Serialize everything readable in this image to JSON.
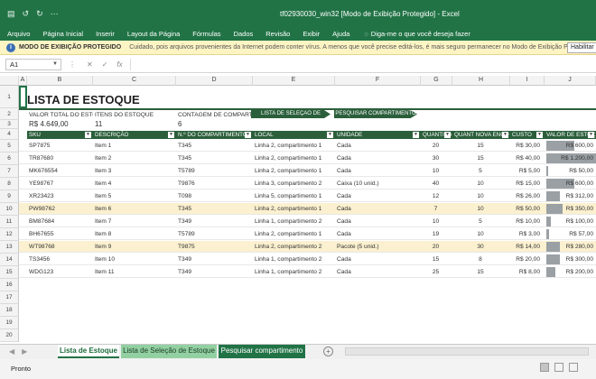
{
  "window": {
    "title": "tf02930030_win32 [Modo de Exibição Protegido] - Excel",
    "qat": [
      "↺",
      "↻",
      "⋯"
    ]
  },
  "ribbon": {
    "tabs": [
      "Arquivo",
      "Página Inicial",
      "Inserir",
      "Layout da Página",
      "Fórmulas",
      "Dados",
      "Revisão",
      "Exibir",
      "Ajuda"
    ],
    "tell_me": "Diga-me o que você deseja fazer"
  },
  "protected": {
    "label": "MODO DE EXIBIÇÃO PROTEGIDO",
    "message": "Cuidado, pois arquivos provenientes da Internet podem conter vírus. A menos que você precise editá-los, é mais seguro permanecer no Modo de Exibição Protegido.",
    "button": "Habilitar Edição"
  },
  "formula_bar": {
    "name_box": "A1",
    "cancel": "✕",
    "enter": "✓",
    "fx": "fx"
  },
  "columns": [
    "A",
    "B",
    "C",
    "D",
    "E",
    "F",
    "G",
    "H",
    "I",
    "J"
  ],
  "rows": [
    "1",
    "2",
    "3",
    "4",
    "5",
    "6",
    "7",
    "8",
    "9",
    "10",
    "11",
    "12",
    "13",
    "14",
    "15",
    "16",
    "17",
    "18",
    "19",
    "20"
  ],
  "sheet": {
    "title": "LISTA DE ESTOQUE",
    "total_label": "VALOR TOTAL DO ESTOQUE",
    "total_value": "R$ 4.649,00",
    "items_label": "ITENS DO ESTOQUE",
    "items_value": "11",
    "bins_label": "CONTAGEM DE COMPARTIMENTOS",
    "bins_value": "6",
    "nav_select": "LISTA DE SELEÇÃO DE ESTOQUE",
    "nav_search": "PESQUISAR COMPARTIMENTO",
    "headers": [
      "SKU",
      "DESCRIÇÃO",
      "N.º DO COMPARTIMENTO",
      "LOCAL",
      "UNIDADE",
      "QUANTIDADE",
      "QUANT NOVA ENCOMENDA",
      "CUSTO",
      "VALOR DE ESTOQUE"
    ],
    "rows": [
      {
        "sku": "SP7875",
        "desc": "Item 1",
        "bin": "T345",
        "loc": "Linha 2, compartimento 1",
        "unit": "Cada",
        "qty": "20",
        "reorder": "15",
        "cost": "R$ 30,00",
        "value": "R$ 600,00",
        "bar": 0.4,
        "hl": false
      },
      {
        "sku": "TR87680",
        "desc": "Item 2",
        "bin": "T345",
        "loc": "Linha 2, compartimento 1",
        "unit": "Cada",
        "qty": "30",
        "reorder": "15",
        "cost": "R$ 40,00",
        "value": "R$ 1.200,00",
        "bar": 0.8,
        "hl": false
      },
      {
        "sku": "MK676554",
        "desc": "Item 3",
        "bin": "T5789",
        "loc": "Linha 2, compartimento 1",
        "unit": "Cada",
        "qty": "10",
        "reorder": "5",
        "cost": "R$ 5,00",
        "value": "R$ 50,00",
        "bar": 0.03,
        "hl": false
      },
      {
        "sku": "YE98767",
        "desc": "Item 4",
        "bin": "T9876",
        "loc": "Linha 3, compartimento 2",
        "unit": "Caixa (10 unid.)",
        "qty": "40",
        "reorder": "10",
        "cost": "R$ 15,00",
        "value": "R$ 600,00",
        "bar": 0.4,
        "hl": false
      },
      {
        "sku": "XR23423",
        "desc": "Item 5",
        "bin": "T098",
        "loc": "Linha 5, compartimento 1",
        "unit": "Cada",
        "qty": "12",
        "reorder": "10",
        "cost": "R$ 26,00",
        "value": "R$ 312,00",
        "bar": 0.2,
        "hl": false
      },
      {
        "sku": "PW98762",
        "desc": "Item 6",
        "bin": "T345",
        "loc": "Linha 2, compartimento 1",
        "unit": "Cada",
        "qty": "7",
        "reorder": "10",
        "cost": "R$ 50,00",
        "value": "R$ 350,00",
        "bar": 0.23,
        "hl": true
      },
      {
        "sku": "BM87684",
        "desc": "Item 7",
        "bin": "T349",
        "loc": "Linha 1, compartimento 2",
        "unit": "Cada",
        "qty": "10",
        "reorder": "5",
        "cost": "R$ 10,00",
        "value": "R$ 100,00",
        "bar": 0.07,
        "hl": false
      },
      {
        "sku": "BH67655",
        "desc": "Item 8",
        "bin": "T5789",
        "loc": "Linha 2, compartimento 1",
        "unit": "Cada",
        "qty": "19",
        "reorder": "10",
        "cost": "R$ 3,00",
        "value": "R$ 57,00",
        "bar": 0.04,
        "hl": false
      },
      {
        "sku": "WT98768",
        "desc": "Item 9",
        "bin": "T9875",
        "loc": "Linha 2, compartimento 2",
        "unit": "Pacote (5 unid.)",
        "qty": "20",
        "reorder": "30",
        "cost": "R$ 14,00",
        "value": "R$ 280,00",
        "bar": 0.19,
        "hl": true
      },
      {
        "sku": "TS3456",
        "desc": "Item 10",
        "bin": "T349",
        "loc": "Linha 1, compartimento 2",
        "unit": "Cada",
        "qty": "15",
        "reorder": "8",
        "cost": "R$ 20,00",
        "value": "R$ 300,00",
        "bar": 0.2,
        "hl": false
      },
      {
        "sku": "WDG123",
        "desc": "Item 11",
        "bin": "T349",
        "loc": "Linha 1, compartimento 2",
        "unit": "Cada",
        "qty": "25",
        "reorder": "15",
        "cost": "R$ 8,00",
        "value": "R$ 200,00",
        "bar": 0.13,
        "hl": false
      }
    ]
  },
  "tabs": [
    "Lista de Estoque",
    "Lista de Seleção de Estoque",
    "Pesquisar compartimento"
  ],
  "status": {
    "ready": "Pronto"
  }
}
